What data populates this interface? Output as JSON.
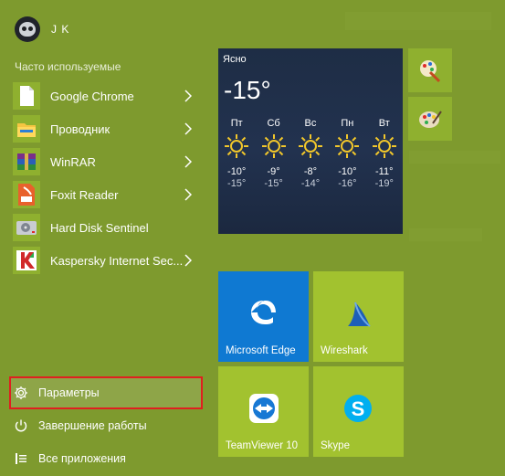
{
  "user": {
    "name": "J K"
  },
  "frequent": {
    "title": "Часто используемые",
    "apps": [
      {
        "label": "Google Chrome",
        "icon": "file-icon",
        "has_submenu": true
      },
      {
        "label": "Проводник",
        "icon": "folder-icon",
        "has_submenu": true
      },
      {
        "label": "WinRAR",
        "icon": "winrar-icon",
        "has_submenu": true
      },
      {
        "label": "Foxit Reader",
        "icon": "pdf-icon",
        "has_submenu": true
      },
      {
        "label": "Hard Disk Sentinel",
        "icon": "hard-disk-icon",
        "has_submenu": false
      },
      {
        "label": "Kaspersky Internet Sec...",
        "icon": "kaspersky-icon",
        "has_submenu": true
      }
    ]
  },
  "bottom": {
    "settings": "Параметры",
    "shutdown": "Завершение работы",
    "all_apps": "Все приложения"
  },
  "weather": {
    "city": "Ясно",
    "temp": "-15°",
    "days": [
      {
        "day": "Пт",
        "hi": "-10°",
        "lo": "-15°"
      },
      {
        "day": "Сб",
        "hi": "-9°",
        "lo": "-15°"
      },
      {
        "day": "Вс",
        "hi": "-8°",
        "lo": "-14°"
      },
      {
        "day": "Пн",
        "hi": "-10°",
        "lo": "-16°"
      },
      {
        "day": "Вт",
        "hi": "-11°",
        "lo": "-19°"
      }
    ]
  },
  "tiles": {
    "edge": "Microsoft Edge",
    "wireshark": "Wireshark",
    "teamviewer": "TeamViewer 10",
    "skype": "Skype"
  },
  "colors": {
    "background": "#7e9a2e",
    "tile_green": "#a2c22f",
    "edge_blue": "#0f79d2",
    "selection_outline": "#e01f1f",
    "sun": "#f2c72b"
  }
}
